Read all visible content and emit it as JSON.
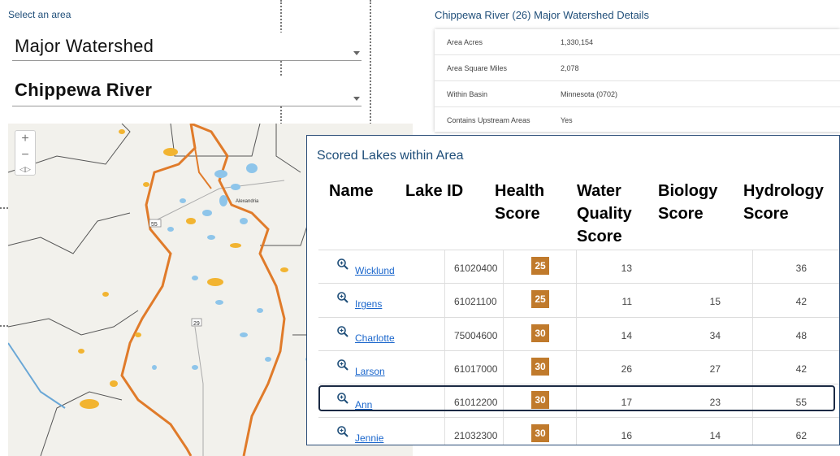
{
  "area_selector": {
    "label": "Select an area",
    "type_value": "Major Watershed",
    "area_value": "Chippewa River"
  },
  "map": {
    "zoom_in": "+",
    "zoom_out": "−",
    "city_label": "Alexandria",
    "route_labels": [
      "55",
      "29"
    ],
    "colors": {
      "land": "#f2f1ec",
      "watershed_boundary": "#e07b2a",
      "county_lines": "#555555",
      "lake_blue": "#8ec5ea",
      "lake_orange": "#f2b431"
    }
  },
  "watershed_details": {
    "title": "Chippewa River (26) Major Watershed Details",
    "rows": [
      {
        "key": "Area Acres",
        "value": "1,330,154"
      },
      {
        "key": "Area Square Miles",
        "value": "2,078"
      },
      {
        "key": "Within Basin",
        "value": "Minnesota (0702)"
      },
      {
        "key": "Contains Upstream Areas",
        "value": "Yes"
      }
    ]
  },
  "lakes": {
    "title": "Scored Lakes within Area",
    "columns": {
      "name": "Name",
      "lake_id": "Lake ID",
      "health_line1": "Health",
      "health_line2": "Score",
      "wq_line1": "Water",
      "wq_line2": "Quality",
      "wq_line3": "Score",
      "bio_line1": "Biology",
      "bio_line2": "Score",
      "hyd_line1": "Hydrology",
      "hyd_line2": "Score"
    },
    "rows": [
      {
        "name": "Wicklund",
        "lake_id": "61020400",
        "health": "25",
        "water_quality": "13",
        "biology": "",
        "hydrology": "36"
      },
      {
        "name": "Irgens",
        "lake_id": "61021100",
        "health": "25",
        "water_quality": "11",
        "biology": "15",
        "hydrology": "42"
      },
      {
        "name": "Charlotte",
        "lake_id": "75004600",
        "health": "30",
        "water_quality": "14",
        "biology": "34",
        "hydrology": "48"
      },
      {
        "name": "Larson",
        "lake_id": "61017000",
        "health": "30",
        "water_quality": "26",
        "biology": "27",
        "hydrology": "42"
      },
      {
        "name": "Ann",
        "lake_id": "61012200",
        "health": "30",
        "water_quality": "17",
        "biology": "23",
        "hydrology": "55"
      },
      {
        "name": "Jennie",
        "lake_id": "21032300",
        "health": "30",
        "water_quality": "16",
        "biology": "14",
        "hydrology": "62"
      }
    ],
    "badge_color": "#c07a2c",
    "highlighted_row": "Ann"
  }
}
